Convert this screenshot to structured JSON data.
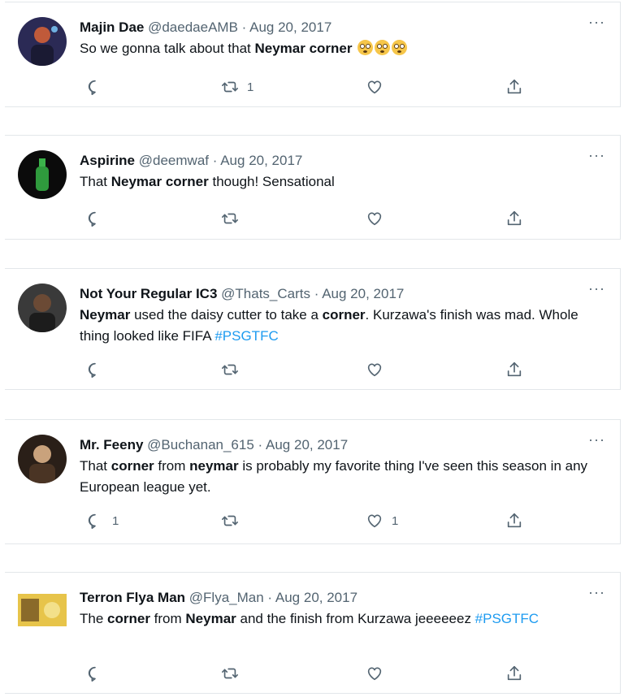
{
  "tweets": [
    {
      "name": "Majin Dae",
      "handle": "@daedaeAMB",
      "date": "Aug 20, 2017",
      "text": [
        {
          "t": "So we gonna talk about that ",
          "s": "plain"
        },
        {
          "t": "Neymar corner",
          "s": "bold"
        },
        {
          "t": " ",
          "s": "plain"
        }
      ],
      "emoji_count": 3,
      "emoji_name": "flushed-face",
      "reply_count": "",
      "retweet_count": "1",
      "like_count": "",
      "avatar_colors": [
        "#2b2a55",
        "#c05a3a"
      ]
    },
    {
      "name": "Aspirine",
      "handle": "@deemwaf",
      "date": "Aug 20, 2017",
      "text": [
        {
          "t": "That ",
          "s": "plain"
        },
        {
          "t": "Neymar corner",
          "s": "bold"
        },
        {
          "t": " though! Sensational",
          "s": "plain"
        }
      ],
      "emoji_count": 0,
      "reply_count": "",
      "retweet_count": "",
      "like_count": "",
      "avatar_colors": [
        "#0b0b0b",
        "#3bb34a"
      ]
    },
    {
      "name": "Not Your Regular IC3",
      "handle": "@Thats_Carts",
      "date": "Aug 20, 2017",
      "text": [
        {
          "t": "Neymar",
          "s": "bold"
        },
        {
          "t": " used the daisy cutter to take a ",
          "s": "plain"
        },
        {
          "t": "corner",
          "s": "bold"
        },
        {
          "t": ". Kurzawa's finish was mad. Whole thing looked like FIFA ",
          "s": "plain"
        },
        {
          "t": "#PSGTFC",
          "s": "hashtag"
        }
      ],
      "emoji_count": 0,
      "reply_count": "",
      "retweet_count": "",
      "like_count": "",
      "avatar_colors": [
        "#3a3a3a",
        "#6b4a35"
      ]
    },
    {
      "name": "Mr. Feeny",
      "handle": "@Buchanan_615",
      "date": "Aug 20, 2017",
      "text": [
        {
          "t": "That ",
          "s": "plain"
        },
        {
          "t": "corner",
          "s": "bold"
        },
        {
          "t": " from ",
          "s": "plain"
        },
        {
          "t": "neymar",
          "s": "bold"
        },
        {
          "t": " is probably my favorite thing I've seen this season in any European league yet.",
          "s": "plain"
        }
      ],
      "emoji_count": 0,
      "reply_count": "1",
      "retweet_count": "",
      "like_count": "1",
      "avatar_colors": [
        "#2a1f18",
        "#c9a27c"
      ]
    },
    {
      "name": "Terron Flya Man",
      "handle": "@Flya_Man",
      "date": "Aug 20, 2017",
      "text": [
        {
          "t": "The ",
          "s": "plain"
        },
        {
          "t": "corner",
          "s": "bold"
        },
        {
          "t": " from ",
          "s": "plain"
        },
        {
          "t": "Neymar",
          "s": "bold"
        },
        {
          "t": " and the finish from Kurzawa jeeeeeez ",
          "s": "plain"
        },
        {
          "t": "#PSGTFC",
          "s": "hashtag"
        }
      ],
      "emoji_count": 0,
      "reply_count": "",
      "retweet_count": "",
      "like_count": "",
      "avatar_colors": [
        "#e7c44a",
        "#8a6a2a"
      ]
    }
  ],
  "dot_separator": "·",
  "more_label": "···",
  "colors": {
    "name": "#0f1419",
    "secondary": "#536471",
    "hashtag": "#1d9bf0",
    "border": "#e3e7ea"
  },
  "icons": [
    "reply-icon",
    "retweet-icon",
    "like-icon",
    "share-icon",
    "more-icon"
  ]
}
